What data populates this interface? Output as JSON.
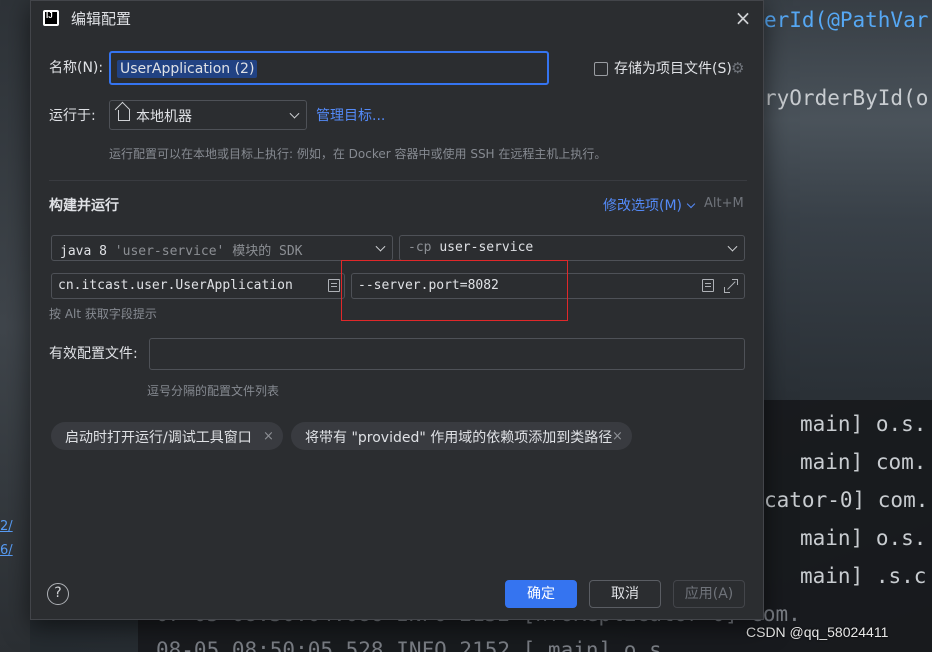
{
  "background": {
    "code_lines": [
      {
        "text": "erId(@PathVar",
        "style": "code"
      },
      {
        "text": "ryOrderById(o",
        "style": "code"
      },
      {
        "text": "main] o.s.",
        "style": "log"
      },
      {
        "text": "main] com.",
        "style": "log"
      },
      {
        "text": "cator-0] com.",
        "style": "log"
      },
      {
        "text": "main] o.s.",
        "style": "log"
      },
      {
        "text": "main] .s.c",
        "style": "log"
      },
      {
        "text": "07-05 08:50:04.086  INFO 2152  [nfoReplicator-0] com.",
        "style": "log"
      },
      {
        "text": "08-05 08:50:05.528  INFO 2152  [           main] o.s.",
        "style": "log"
      }
    ],
    "left_links": [
      "2/",
      "6/"
    ],
    "watermark": "CSDN @qq_58024411"
  },
  "dialog": {
    "title": "编辑配置",
    "name_label": "名称(N):",
    "name_value": "UserApplication (2)",
    "store_as_file_label": "存储为项目文件(S)",
    "run_on_label": "运行于:",
    "run_on_value": "本地机器",
    "manage_targets_link": "管理目标...",
    "run_on_hint": "运行配置可以在本地或目标上执行: 例如，在 Docker 容器中或使用 SSH 在远程主机上执行。",
    "build_run_title": "构建并运行",
    "modify_options_link": "修改选项(M)",
    "modify_options_shortcut": "Alt+M",
    "jdk_select": {
      "main": "java 8",
      "detail": "'user-service' 模块的 SDK"
    },
    "classpath_select": {
      "flag": "-cp",
      "module": "user-service"
    },
    "main_class_value": "cn.itcast.user.UserApplication",
    "program_args_value": "--server.port=8082",
    "alt_hint": "按 Alt 获取字段提示",
    "active_profiles_label": "有效配置文件:",
    "active_profiles_value": "",
    "active_profiles_hint": "逗号分隔的配置文件列表",
    "chips": [
      {
        "label": "启动时打开运行/调试工具窗口"
      },
      {
        "label": "将带有 \"provided\" 作用域的依赖项添加到类路径"
      }
    ],
    "buttons": {
      "ok": "确定",
      "cancel": "取消",
      "apply": "应用(A)"
    },
    "help_glyph": "?",
    "close_glyph": "×",
    "chip_close_glyph": "×",
    "gear_glyph": "⚙"
  },
  "colors": {
    "accent": "#3574f0",
    "link": "#548af7",
    "highlight_box": "#e0282a",
    "dialog_bg": "#2b2d30"
  }
}
